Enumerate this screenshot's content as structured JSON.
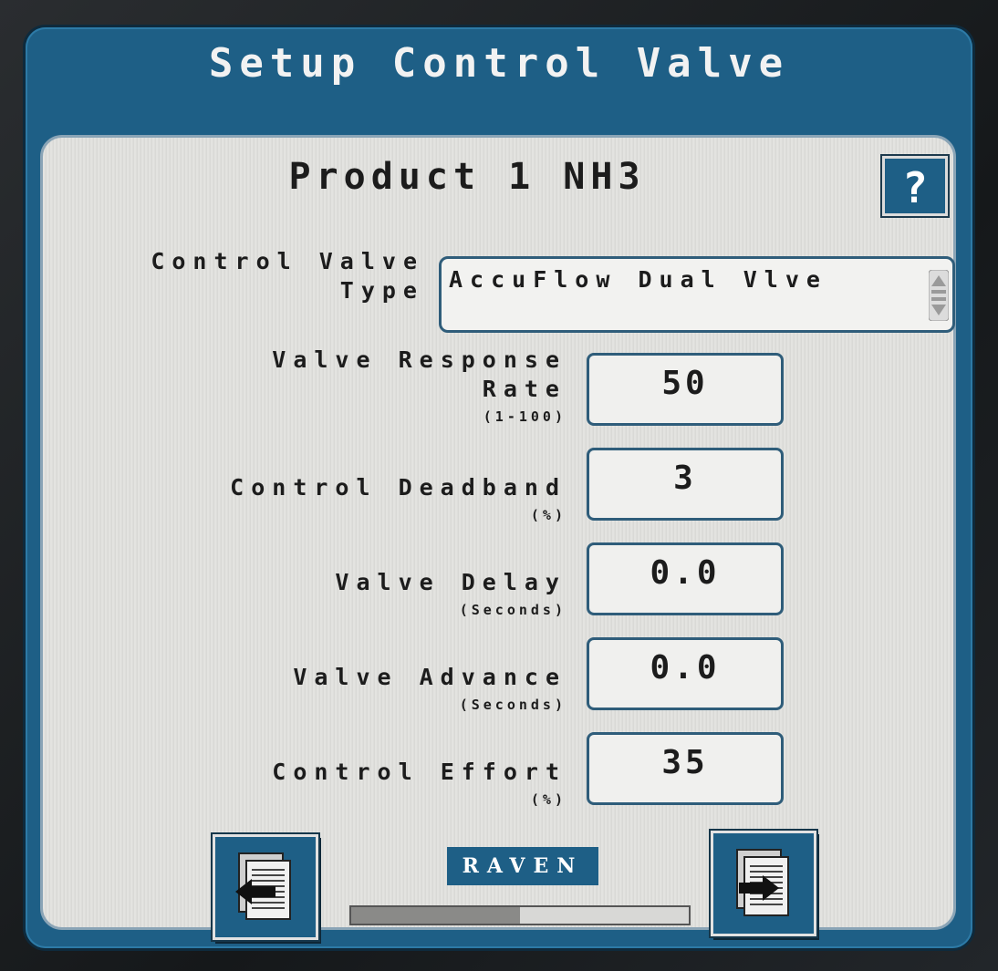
{
  "header": {
    "title": "Setup Control Valve"
  },
  "panel": {
    "title": "Product 1 NH3",
    "help_label": "?"
  },
  "control_valve_type": {
    "label_line1": "Control Valve",
    "label_line2": "Type",
    "value": "AccuFlow Dual Vlve"
  },
  "fields": {
    "valve_response_rate": {
      "label_line1": "Valve Response",
      "label_line2": "Rate",
      "unit": "(1-100)",
      "value": "50"
    },
    "control_deadband": {
      "label": "Control Deadband",
      "unit": "(%)",
      "value": "3"
    },
    "valve_delay": {
      "label": "Valve Delay",
      "unit": "(Seconds)",
      "value": "0.0"
    },
    "valve_advance": {
      "label": "Valve Advance",
      "unit": "(Seconds)",
      "value": "0.0"
    },
    "control_effort": {
      "label": "Control Effort",
      "unit": "(%)",
      "value": "35"
    }
  },
  "footer": {
    "brand": "RAVEN",
    "prev_icon": "page-back-icon",
    "next_icon": "page-forward-icon",
    "progress_fraction": 0.5
  },
  "colors": {
    "accent": "#1e5f86",
    "panel": "#e0e0de",
    "border": "#2f5d7a"
  }
}
